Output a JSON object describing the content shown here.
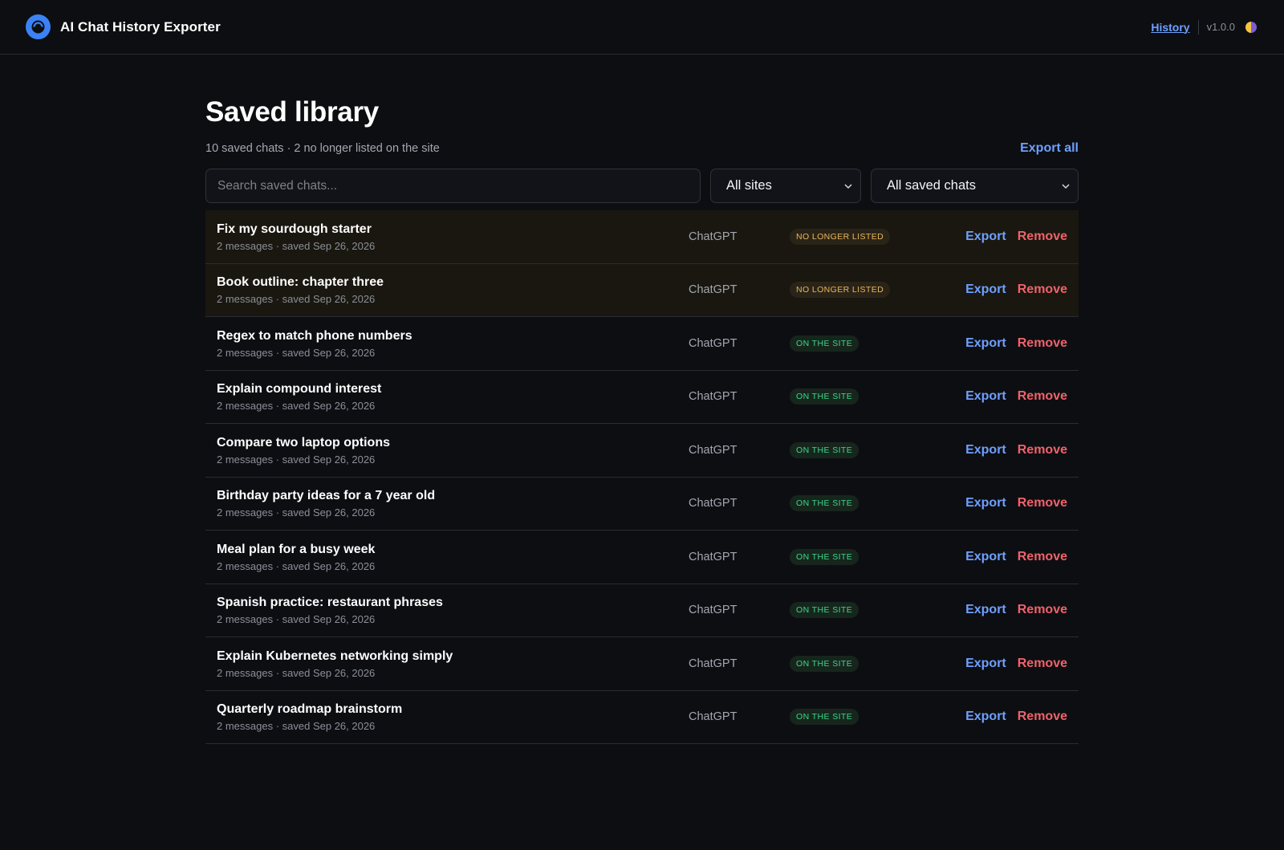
{
  "app": {
    "name": "AI Chat History Exporter",
    "nav_history": "History",
    "version": "v1.0.0"
  },
  "page": {
    "title": "Saved library",
    "summary": "10 saved chats · 2 no longer listed on the site",
    "export_all": "Export all"
  },
  "filters": {
    "search_placeholder": "Search saved chats...",
    "site_selected": "All sites",
    "state_selected": "All saved chats"
  },
  "actions": {
    "export": "Export",
    "remove": "Remove"
  },
  "colors": {
    "accent": "#6ea0ff",
    "danger": "#f0626a",
    "stale_badge": "#e9b65a",
    "live_badge": "#3dd68c"
  },
  "chats": [
    {
      "title": "Fix my sourdough starter",
      "meta": "2 messages · saved Sep 26, 2026",
      "site": "ChatGPT",
      "status": "NO LONGER LISTED",
      "stale": true
    },
    {
      "title": "Book outline: chapter three",
      "meta": "2 messages · saved Sep 26, 2026",
      "site": "ChatGPT",
      "status": "NO LONGER LISTED",
      "stale": true
    },
    {
      "title": "Regex to match phone numbers",
      "meta": "2 messages · saved Sep 26, 2026",
      "site": "ChatGPT",
      "status": "ON THE SITE",
      "stale": false
    },
    {
      "title": "Explain compound interest",
      "meta": "2 messages · saved Sep 26, 2026",
      "site": "ChatGPT",
      "status": "ON THE SITE",
      "stale": false
    },
    {
      "title": "Compare two laptop options",
      "meta": "2 messages · saved Sep 26, 2026",
      "site": "ChatGPT",
      "status": "ON THE SITE",
      "stale": false
    },
    {
      "title": "Birthday party ideas for a 7 year old",
      "meta": "2 messages · saved Sep 26, 2026",
      "site": "ChatGPT",
      "status": "ON THE SITE",
      "stale": false
    },
    {
      "title": "Meal plan for a busy week",
      "meta": "2 messages · saved Sep 26, 2026",
      "site": "ChatGPT",
      "status": "ON THE SITE",
      "stale": false
    },
    {
      "title": "Spanish practice: restaurant phrases",
      "meta": "2 messages · saved Sep 26, 2026",
      "site": "ChatGPT",
      "status": "ON THE SITE",
      "stale": false
    },
    {
      "title": "Explain Kubernetes networking simply",
      "meta": "2 messages · saved Sep 26, 2026",
      "site": "ChatGPT",
      "status": "ON THE SITE",
      "stale": false
    },
    {
      "title": "Quarterly roadmap brainstorm",
      "meta": "2 messages · saved Sep 26, 2026",
      "site": "ChatGPT",
      "status": "ON THE SITE",
      "stale": false
    }
  ]
}
